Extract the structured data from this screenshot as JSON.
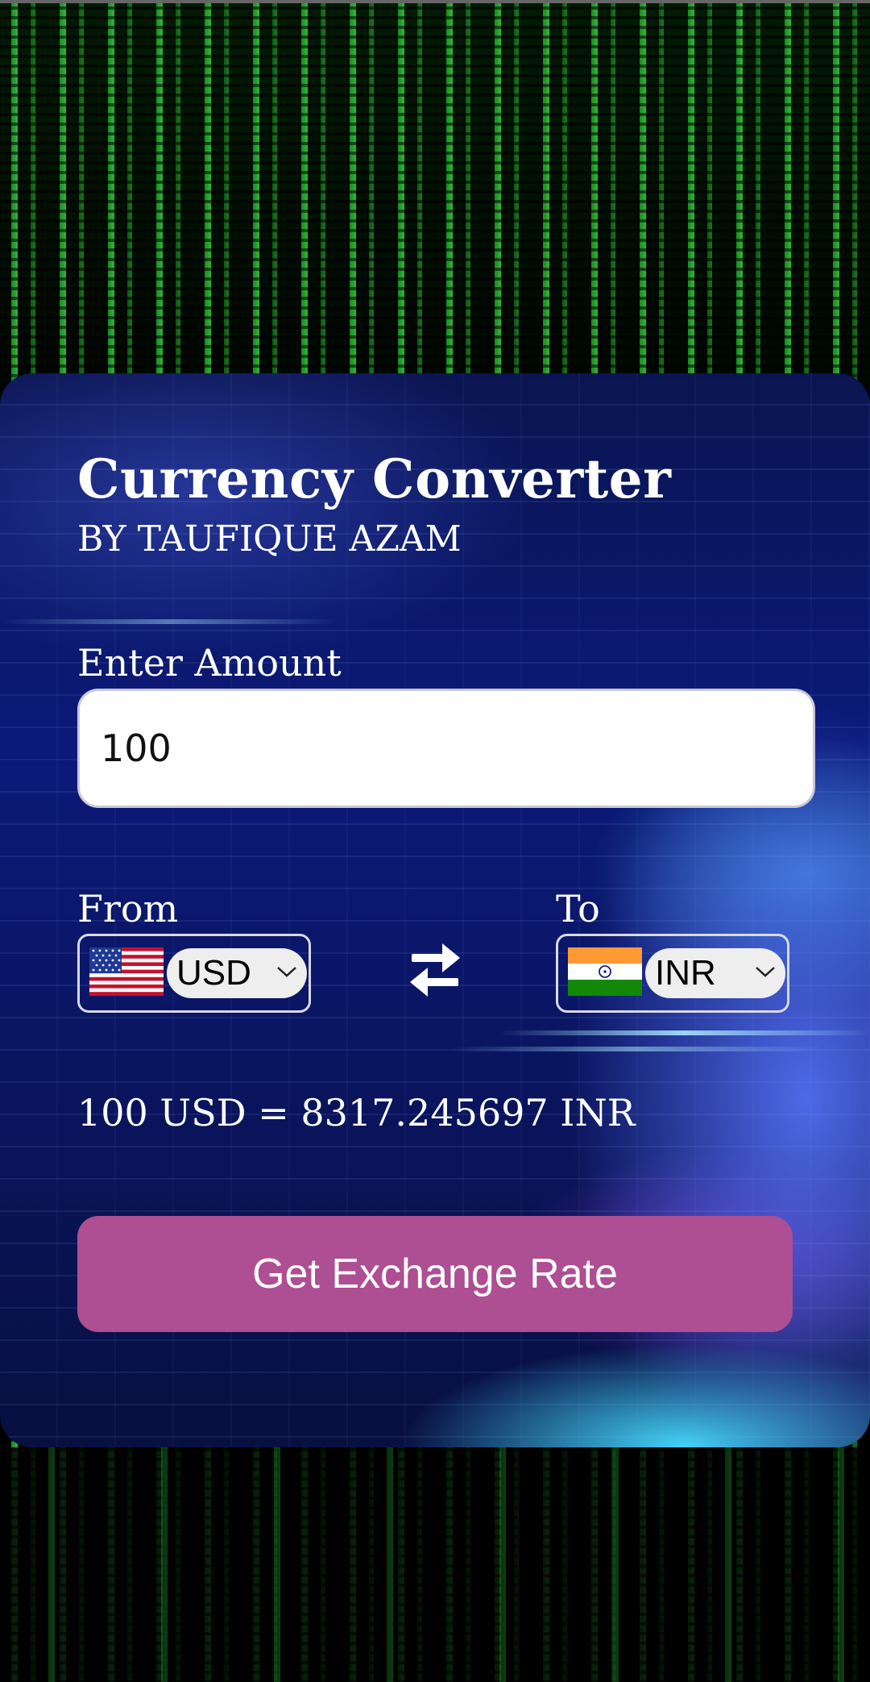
{
  "app": {
    "title": "Currency Converter",
    "subtitle": "BY TAUFIQUE AZAM"
  },
  "amount": {
    "label": "Enter Amount",
    "value": "100"
  },
  "from": {
    "label": "From",
    "currency": "USD",
    "flag": "us-flag-icon"
  },
  "to": {
    "label": "To",
    "currency": "INR",
    "flag": "india-flag-icon"
  },
  "swap": {
    "icon": "swap-arrows-icon"
  },
  "result": {
    "text": "100 USD = 8317.245697 INR"
  },
  "button": {
    "label": "Get Exchange Rate",
    "color": "#ad4f92"
  }
}
